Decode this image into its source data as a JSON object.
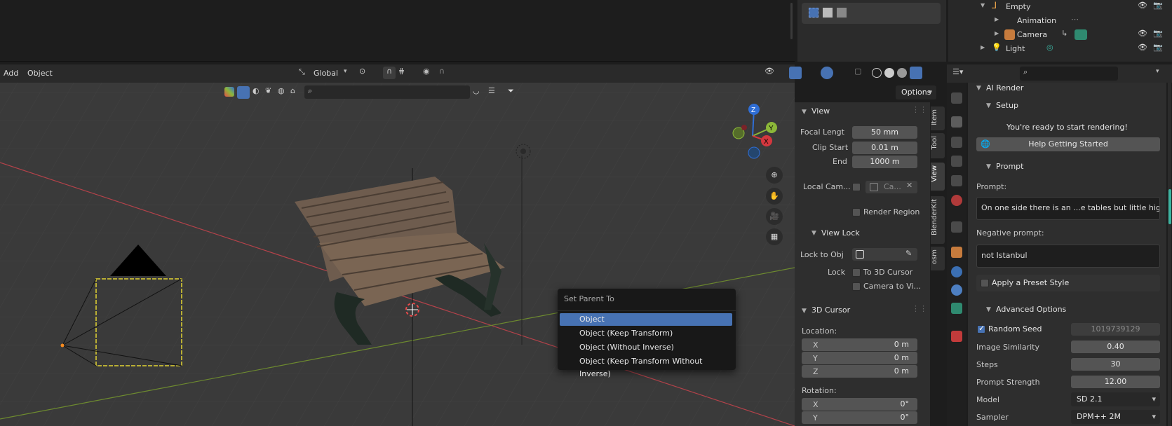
{
  "header_menu": {
    "add": "Add",
    "object": "Object"
  },
  "toolbar": {
    "transform_orientation": "Global",
    "options": "Options"
  },
  "outliner": {
    "items": [
      {
        "label": "Empty",
        "level": 0
      },
      {
        "label": "Animation",
        "level": 1
      },
      {
        "label": "Camera",
        "level": 1
      },
      {
        "label": "Light",
        "level": 0
      }
    ]
  },
  "context_menu": {
    "title": "Set Parent To",
    "items": [
      "Object",
      "Object (Keep Transform)",
      "Object (Without Inverse)",
      "Object (Keep Transform Without Inverse)"
    ],
    "selected_index": 0
  },
  "n_panel": {
    "tabs": [
      "Item",
      "Tool",
      "View",
      "BlenderKit",
      "osm"
    ],
    "active_tab": "View",
    "view": {
      "header": "View",
      "focal_length_label": "Focal Lengt",
      "focal_length": "50 mm",
      "clip_start_label": "Clip Start",
      "clip_start": "0.01 m",
      "clip_end_label": "End",
      "clip_end": "1000 m",
      "local_camera_label": "Local Cam...",
      "local_camera_value": "Ca...",
      "render_region": "Render Region"
    },
    "view_lock": {
      "header": "View Lock",
      "lock_to_obj_label": "Lock to Obj",
      "lock_label": "Lock",
      "to_3d_cursor": "To 3D Cursor",
      "camera_to_view": "Camera to Vi..."
    },
    "cursor": {
      "header": "3D Cursor",
      "location_label": "Location:",
      "x_label": "X",
      "x": "0 m",
      "y_label": "Y",
      "y": "0 m",
      "z_label": "Z",
      "z": "0 m",
      "rotation_label": "Rotation:",
      "rx_label": "X",
      "rx": "0°",
      "ry_label": "Y",
      "ry": "0°"
    }
  },
  "ai_render": {
    "header": "AI Render",
    "setup_header": "Setup",
    "ready_text": "You're ready to start rendering!",
    "help_button": "Help Getting Started",
    "prompt_header": "Prompt",
    "prompt_label": "Prompt:",
    "prompt_value": "On one side there is an ...e tables but little higher t",
    "negative_label": "Negative prompt:",
    "negative_value": "not Istanbul",
    "preset_style": "Apply a Preset Style",
    "advanced_header": "Advanced Options",
    "random_seed_label": "Random Seed",
    "random_seed_value": "1019739129",
    "random_seed_checked": true,
    "image_similarity_label": "Image Similarity",
    "image_similarity_value": "0.40",
    "steps_label": "Steps",
    "steps_value": "30",
    "prompt_strength_label": "Prompt Strength",
    "prompt_strength_value": "12.00",
    "model_label": "Model",
    "model_value": "SD 2.1",
    "sampler_label": "Sampler",
    "sampler_value": "DPM++ 2M"
  },
  "gizmo": {
    "z": "Z",
    "y": "Y",
    "x": "X"
  },
  "colors": {
    "accent": "#4772b3",
    "x_axis": "#d4373e",
    "y_axis": "#8cb839",
    "z_axis": "#2f6ed6",
    "selection": "#e3d533"
  }
}
